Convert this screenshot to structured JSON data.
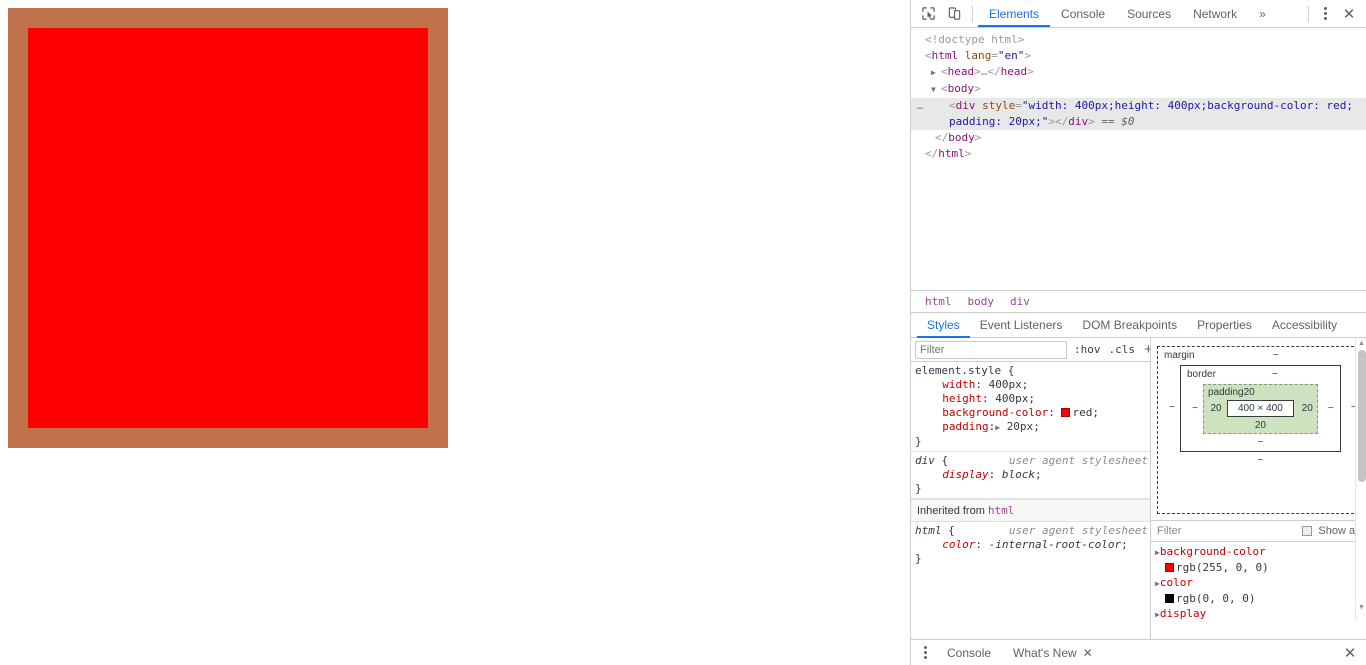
{
  "page": {
    "rendered_box": {
      "content_color": "#ff0000",
      "padding_overlay_color": "#c0704a",
      "content_width_px": "400",
      "content_height_px": "400",
      "padding_px": "20"
    }
  },
  "devtools": {
    "toolbar": {
      "inspect_icon": "inspect-element-icon",
      "device_icon": "device-toolbar-icon",
      "tabs": [
        {
          "label": "Elements",
          "active": true
        },
        {
          "label": "Console",
          "active": false
        },
        {
          "label": "Sources",
          "active": false
        },
        {
          "label": "Network",
          "active": false
        }
      ],
      "overflow_label": "»",
      "more_icon": "more-options-icon",
      "close_label": "✕"
    },
    "dom": {
      "lines": [
        {
          "text": "<!doctype html>",
          "kind": "doctype"
        },
        {
          "text": "<html lang=\"en\">",
          "kind": "open"
        },
        {
          "text": "<head>…</head>",
          "kind": "collapsed"
        },
        {
          "text": "<body>",
          "kind": "expanded"
        },
        {
          "text": "<div style=\"width: 400px;height: 400px;background-color: red;padding: 20px;\"></div> == $0",
          "kind": "selected"
        },
        {
          "text": "</body>",
          "kind": "close"
        },
        {
          "text": "</html>",
          "kind": "close"
        }
      ],
      "doctype": "<!doctype html>",
      "html_tag": "html",
      "html_attr_name": "lang",
      "html_attr_value": "\"en\"",
      "head_tag": "head",
      "body_tag": "body",
      "div_tag": "div",
      "div_attr_name": "style",
      "div_attr_value_line1": "\"width: 400px;height: 400px;background-color: red;",
      "div_attr_value_line2": "padding: 20px;\"",
      "selected_marker": "== $0",
      "row_badge": "…"
    },
    "breadcrumb": [
      "html",
      "body",
      "div"
    ],
    "sub_tabs": [
      {
        "label": "Styles",
        "active": true
      },
      {
        "label": "Event Listeners",
        "active": false
      },
      {
        "label": "DOM Breakpoints",
        "active": false
      },
      {
        "label": "Properties",
        "active": false
      },
      {
        "label": "Accessibility",
        "active": false
      }
    ],
    "styles": {
      "filter_placeholder": "Filter",
      "filter_value": "",
      "hov_label": ":hov",
      "cls_label": ".cls",
      "new_rule_label": "+",
      "rules": [
        {
          "selector": "element.style",
          "origin": "",
          "declarations": [
            {
              "prop": "width",
              "value": "400px"
            },
            {
              "prop": "height",
              "value": "400px"
            },
            {
              "prop": "background-color",
              "value": "red",
              "swatch": "#ff0000"
            },
            {
              "prop": "padding",
              "value": "20px",
              "expandable": true
            }
          ]
        },
        {
          "selector": "div",
          "origin": "user agent stylesheet",
          "declarations": [
            {
              "prop": "display",
              "value": "block"
            }
          ]
        }
      ],
      "inherited_label": "Inherited from",
      "inherited_from": "html",
      "inherited_rules": [
        {
          "selector": "html",
          "origin": "user agent stylesheet",
          "declarations": [
            {
              "prop": "color",
              "value": "-internal-root-color"
            }
          ]
        }
      ]
    },
    "metrics": {
      "margin_label": "margin",
      "border_label": "border",
      "padding_label": "padding",
      "margin_top": "−",
      "margin_right": "−",
      "margin_bottom": "−",
      "margin_left": "−",
      "border_top": "−",
      "border_right": "−",
      "border_bottom": "−",
      "border_left": "−",
      "padding_top": "20",
      "padding_right": "20",
      "padding_bottom": "20",
      "padding_left": "20",
      "content_size": "400 × 400"
    },
    "computed": {
      "filter_placeholder": "Filter",
      "show_all_label": "Show all",
      "show_all_checked": false,
      "properties": [
        {
          "name": "background-color",
          "value": "rgb(255, 0, 0)",
          "swatch": "#ff0000"
        },
        {
          "name": "color",
          "value": "rgb(0, 0, 0)",
          "swatch": "#000000"
        },
        {
          "name": "display",
          "value": ""
        }
      ]
    },
    "drawer": {
      "menu_icon": "drawer-menu-icon",
      "tabs": [
        {
          "label": "Console",
          "closable": false
        },
        {
          "label": "What's New",
          "closable": true
        }
      ],
      "close_label": "✕"
    }
  }
}
